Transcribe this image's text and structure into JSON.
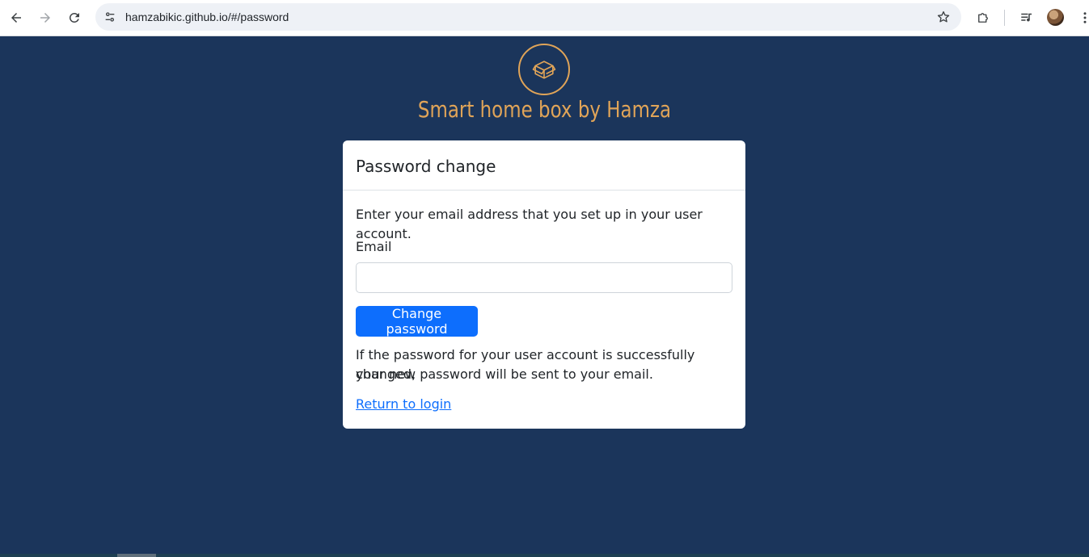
{
  "browser": {
    "url": "hamzabikic.github.io/#/password",
    "icons": {
      "back": "arrow-left-icon",
      "forward": "arrow-right-icon",
      "reload": "reload-icon",
      "site_info": "tune-icon",
      "bookmark": "star-icon",
      "extensions": "puzzle-icon",
      "media": "queue-music-icon",
      "profile": "avatar",
      "menu": "kebab-menu-icon"
    }
  },
  "brand": {
    "title": "Smart home box by Hamza",
    "logo_icon": "open-box-icon",
    "accent_color": "#e0a458"
  },
  "card": {
    "title": "Password change",
    "instruction": "Enter your email address that you set up in your user account.",
    "email_label": "Email",
    "email_value": "",
    "email_placeholder": "",
    "submit_label": "Change password",
    "note_line1": "If the password for your user account is successfully changed,",
    "note_line2": "your new password will be sent to your email.",
    "return_link": "Return to login"
  },
  "colors": {
    "page_background": "#1b355b",
    "primary": "#0d6efd",
    "card_background": "#ffffff"
  }
}
